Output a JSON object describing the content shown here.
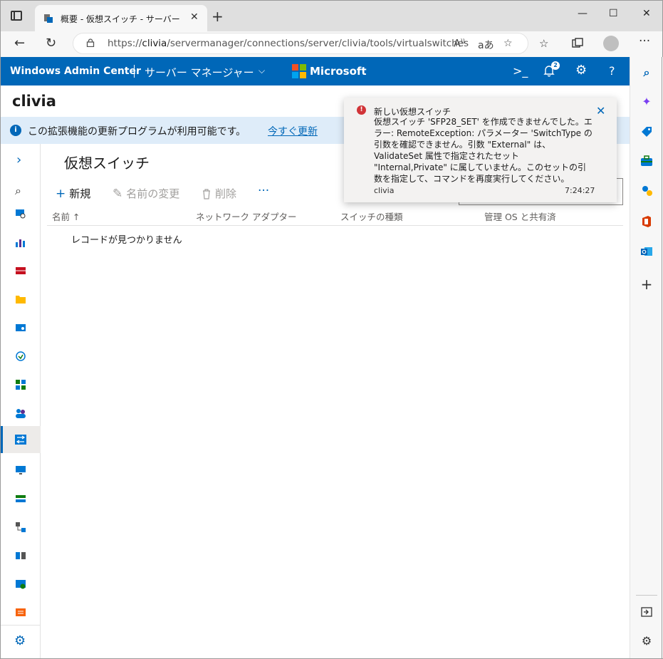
{
  "browser": {
    "tab_title": "概要 - 仮想スイッチ - サーバー マネージャー",
    "tab_close": "✕",
    "new_tab": "+",
    "url_prefix": "https://",
    "url_host": "clivia",
    "url_path": "/servermanager/connections/server/clivia/tools/virtualswitches",
    "window_controls": {
      "minimize": "—",
      "maximize": "☐",
      "close": "✕"
    },
    "nav": {
      "back": "←",
      "refresh": "↻",
      "more": "···"
    }
  },
  "header": {
    "brand": "Windows Admin Center",
    "app_name": "サーバー マネージャー",
    "microsoft": "Microsoft",
    "notification_count": "2",
    "colors": {
      "bar": "#0067b8",
      "logo": [
        "#f25022",
        "#7fba00",
        "#00a4ef",
        "#ffb900"
      ]
    }
  },
  "server": {
    "name": "clivia"
  },
  "banner": {
    "message": "この拡張機能の更新プログラムが利用可能です。",
    "link": "今すぐ更新"
  },
  "tool": {
    "title": "仮想スイッチ",
    "commands": {
      "new": "新規",
      "rename": "名前の変更",
      "delete": "削除",
      "more": "···"
    },
    "columns": [
      "名前 ↑",
      "ネットワーク アダプター",
      "スイッチの種類",
      "管理 OS と共有済"
    ],
    "empty_message": "レコードが見つかりません"
  },
  "toast": {
    "title": "新しい仮想スイッチ",
    "body": "仮想スイッチ 'SFP28_SET' を作成できませんでした。エラー: RemoteException: パラメーター 'SwitchType の引数を確認できません。引数 \"External\" は、ValidateSet 属性で指定されたセット \"Internal,Private\" に属していません。このセットの引数を指定して、コマンドを再度実行してください。",
    "server": "clivia",
    "time": "7:24:27",
    "close": "✕",
    "error_color": "#d13438"
  },
  "rail": {
    "icons": [
      "server-manager-icon",
      "performance-icon",
      "firewall-icon",
      "files-icon",
      "storage-icon",
      "updates-icon",
      "apps-icon",
      "users-icon",
      "virtual-switches-icon",
      "remote-desktop-icon",
      "disks-icon",
      "network-icon",
      "services-icon",
      "scheduled-tasks-icon",
      "certificates-icon",
      "settings-icon"
    ]
  }
}
